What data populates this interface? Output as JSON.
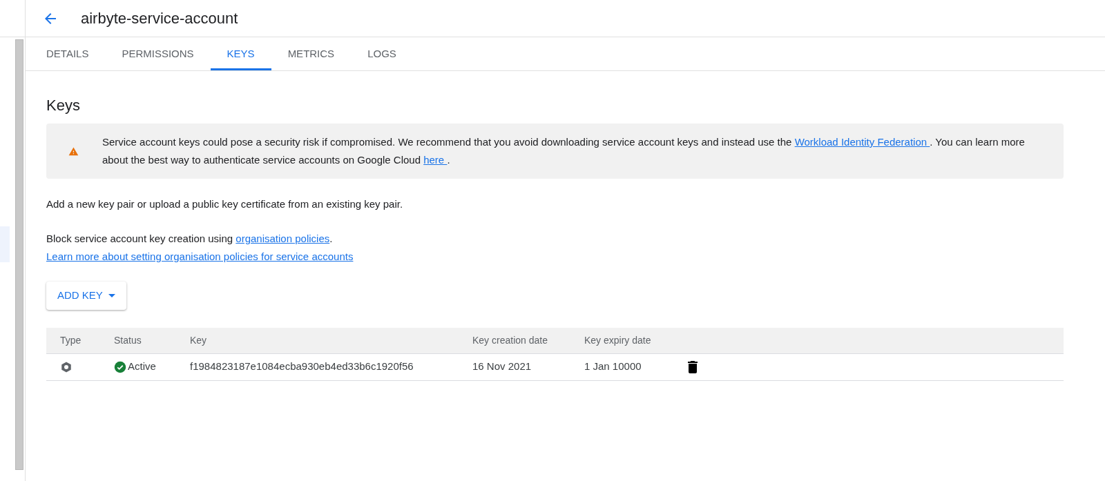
{
  "header": {
    "title": "airbyte-service-account"
  },
  "tabs": [
    {
      "label": "DETAILS",
      "selected": false
    },
    {
      "label": "PERMISSIONS",
      "selected": false
    },
    {
      "label": "KEYS",
      "selected": true
    },
    {
      "label": "METRICS",
      "selected": false
    },
    {
      "label": "LOGS",
      "selected": false
    }
  ],
  "heading": "Keys",
  "notice": {
    "text_1": "Service account keys could pose a security risk if compromised. We recommend that you avoid downloading service account keys and instead use the ",
    "link_1": "Workload Identity Federation ",
    "text_2": ". You can learn more about the best way to authenticate service accounts on Google Cloud ",
    "link_2": "here ",
    "text_3": "."
  },
  "intro": "Add a new key pair or upload a public key certificate from an existing key pair.",
  "policy": {
    "text": "Block service account key creation using ",
    "link": "organisation policies",
    "end": "."
  },
  "learn_more": "Learn more about setting organisation policies for service accounts",
  "add_key_button": "ADD KEY",
  "table": {
    "columns": [
      "Type",
      "Status",
      "Key",
      "Key creation date",
      "Key expiry date"
    ],
    "rows": [
      {
        "status": {
          "label": "Active",
          "kind": "active"
        },
        "key": "f1984823187e1084ecba930eb4ed33b6c1920f56",
        "created": "16 Nov 2021",
        "expiry": "1 Jan 10000"
      }
    ]
  }
}
